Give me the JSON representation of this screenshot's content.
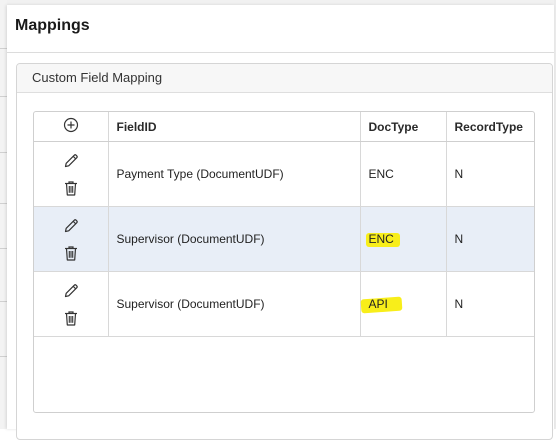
{
  "dialog": {
    "title": "Mappings"
  },
  "panel": {
    "title": "Custom Field Mapping"
  },
  "grid": {
    "columns": {
      "field_id": "FieldID",
      "doc_type": "DocType",
      "record_type": "RecordType"
    },
    "rows": [
      {
        "field_id": "Payment Type (DocumentUDF)",
        "doc_type": "ENC",
        "record_type": "N",
        "selected": false
      },
      {
        "field_id": "Supervisor (DocumentUDF)",
        "doc_type": "ENC",
        "record_type": "N",
        "selected": true
      },
      {
        "field_id": "Supervisor (DocumentUDF)",
        "doc_type": "API",
        "record_type": "N",
        "selected": false
      }
    ]
  },
  "icons": {
    "add": "plus-circle-icon",
    "edit": "pencil-icon",
    "delete": "trash-icon"
  },
  "colors": {
    "selected_row": "#e8eef7",
    "highlight": "#f8ee1a"
  }
}
